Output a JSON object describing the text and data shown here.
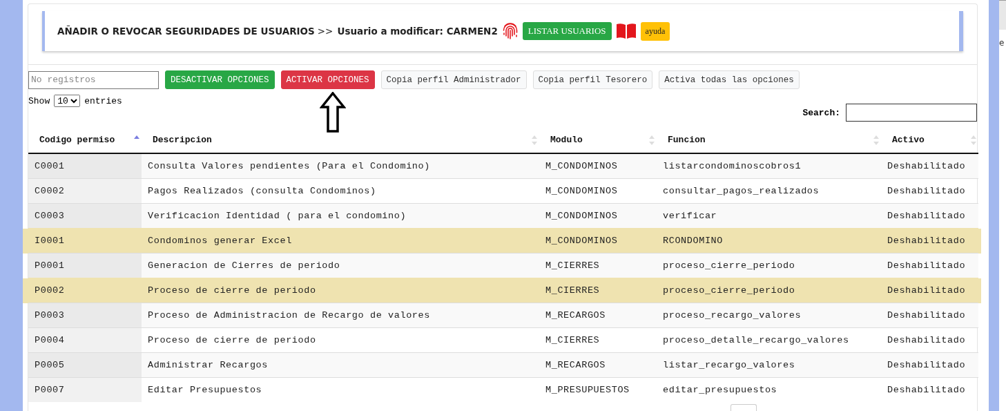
{
  "header": {
    "title": "AÑADIR O REVOCAR SEGURIDADES DE USUARIOS",
    "separator": ">>",
    "subtitle": "Usuario a modificar: CARMEN2",
    "list_button": "LISTAR USUARIOS",
    "help_button": "ayuda"
  },
  "toolbar": {
    "records_field": {
      "placeholder": "No registros"
    },
    "buttons": [
      {
        "label": "DESACTIVAR OPCIONES",
        "kind": "success"
      },
      {
        "label": "ACTIVAR OPCIONES",
        "kind": "danger"
      },
      {
        "label": "Copia perfil Administrador",
        "kind": "light"
      },
      {
        "label": "Copia perfil Tesorero",
        "kind": "light"
      },
      {
        "label": "Activa todas las opciones",
        "kind": "light"
      }
    ]
  },
  "length_menu": {
    "prefix": "Show",
    "value": "10",
    "suffix": "entries"
  },
  "search": {
    "label": "Search:"
  },
  "table": {
    "columns": [
      {
        "label": "Codigo permiso",
        "sorted": true
      },
      {
        "label": "Descripcion",
        "sorted": false
      },
      {
        "label": "Modulo",
        "sorted": false
      },
      {
        "label": "Funcion",
        "sorted": false
      },
      {
        "label": "Activo",
        "sorted": false
      }
    ],
    "rows": [
      {
        "cells": [
          "C0001",
          "Consulta Valores pendientes (Para el Condomino)",
          "M_CONDOMINOS",
          "listarcondominoscobros1",
          "Deshabilitado"
        ],
        "highlighted": false
      },
      {
        "cells": [
          "C0002",
          "Pagos Realizados (consulta Condominos)",
          "M_CONDOMINOS",
          "consultar_pagos_realizados",
          "Deshabilitado"
        ],
        "highlighted": false
      },
      {
        "cells": [
          "C0003",
          "Verificacion Identidad ( para el condomino)",
          "M_CONDOMINOS",
          "verificar",
          "Deshabilitado"
        ],
        "highlighted": false
      },
      {
        "cells": [
          "I0001",
          "Condominos generar Excel",
          "M_CONDOMINOS",
          "RCONDOMINO",
          "Deshabilitado"
        ],
        "highlighted": true
      },
      {
        "cells": [
          "P0001",
          "Generacion de Cierres de periodo",
          "M_CIERRES",
          "proceso_cierre_periodo",
          "Deshabilitado"
        ],
        "highlighted": false
      },
      {
        "cells": [
          "P0002",
          "Proceso de cierre de periodo",
          "M_CIERRES",
          "proceso_cierre_periodo",
          "Deshabilitado"
        ],
        "highlighted": true
      },
      {
        "cells": [
          "P0003",
          "Proceso de Administracion de Recargo de valores",
          "M_RECARGOS",
          "proceso_recargo_valores",
          "Deshabilitado"
        ],
        "highlighted": false
      },
      {
        "cells": [
          "P0004",
          "Proceso de cierre de periodo",
          "M_CIERRES",
          "proceso_detalle_recargo_valores",
          "Deshabilitado"
        ],
        "highlighted": false
      },
      {
        "cells": [
          "P0005",
          "Administrar Recargos",
          "M_RECARGOS",
          "listar_recargo_valores",
          "Deshabilitado"
        ],
        "highlighted": false
      },
      {
        "cells": [
          "P0007",
          "Editar Presupuestos",
          "M_PRESUPUESTOS",
          "editar_presupuestos",
          "Deshabilitado"
        ],
        "highlighted": false
      }
    ]
  },
  "side_text": "e"
}
